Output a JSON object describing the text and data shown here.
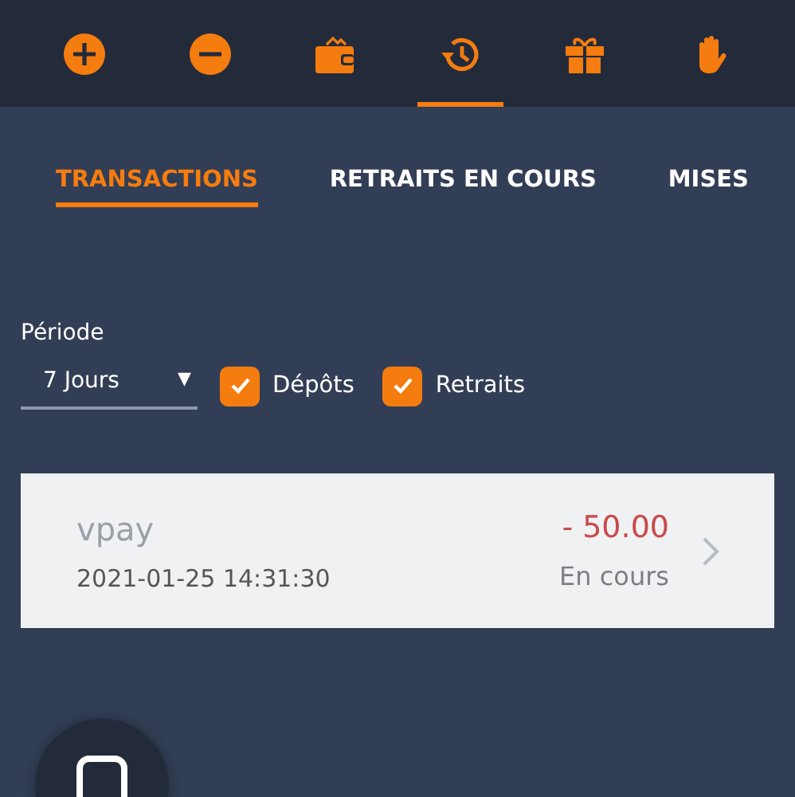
{
  "nav_icons": [
    {
      "kind": "plus",
      "selected": false
    },
    {
      "kind": "minus",
      "selected": false
    },
    {
      "kind": "wallet",
      "selected": false
    },
    {
      "kind": "history",
      "selected": true
    },
    {
      "kind": "gift",
      "selected": false
    },
    {
      "kind": "hand",
      "selected": false
    }
  ],
  "tabs": [
    {
      "label": "TRANSACTIONS",
      "selected": true
    },
    {
      "label": "RETRAITS EN COURS",
      "selected": false
    },
    {
      "label": "MISES",
      "selected": false
    }
  ],
  "filters": {
    "period_label": "Période",
    "period_value": "7 Jours",
    "caret": "▼",
    "checkboxes": [
      {
        "label": "Dépôts",
        "checked": true
      },
      {
        "label": "Retraits",
        "checked": true
      }
    ]
  },
  "transactions": [
    {
      "method": "vpay",
      "date": "2021-01-25 14:31:30",
      "amount": "- 50.00",
      "status": "En cours"
    }
  ]
}
